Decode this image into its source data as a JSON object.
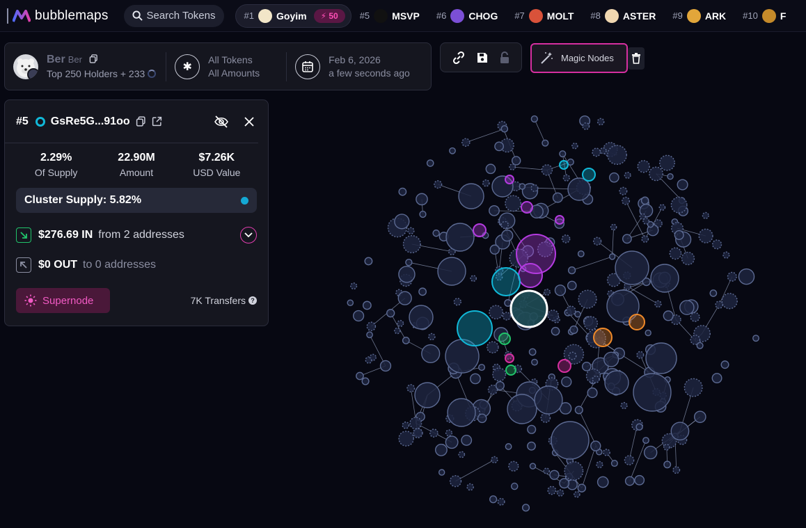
{
  "brand": {
    "name": "bubblemaps"
  },
  "search": {
    "label": "Search Tokens"
  },
  "tokens": [
    {
      "rank": "#1",
      "name": "Goyim",
      "icon": "goyim-token-icon",
      "color": "#f2e6c8",
      "active": true,
      "badge": "50"
    },
    {
      "rank": "#5",
      "name": "MSVP",
      "icon": "msvp-token-icon",
      "color": "#111111"
    },
    {
      "rank": "#6",
      "name": "CHOG",
      "icon": "chog-token-icon",
      "color": "#7b4fd6"
    },
    {
      "rank": "#7",
      "name": "MOLT",
      "icon": "molt-token-icon",
      "color": "#d9523a"
    },
    {
      "rank": "#8",
      "name": "ASTER",
      "icon": "aster-token-icon",
      "color": "#f0d7b0"
    },
    {
      "rank": "#9",
      "name": "ARK",
      "icon": "ark-token-icon",
      "color": "#e2a63a"
    },
    {
      "rank": "#10",
      "name": "F",
      "icon": "token-icon",
      "color": "#c58a2a"
    }
  ],
  "header": {
    "token_name": "Ber",
    "token_symbol": "Ber",
    "holders": "Top 250 Holders + 233",
    "filter_tokens": "All Tokens",
    "filter_amounts": "All Amounts",
    "date": "Feb 6, 2026",
    "date_relative": "a few seconds ago"
  },
  "toolbar": {
    "magic_nodes": "Magic Nodes"
  },
  "detail": {
    "rank": "#5",
    "address": "GsRe5G...91oo",
    "supply_pct": "2.29%",
    "supply_label": "Of Supply",
    "amount": "22.90M",
    "amount_label": "Amount",
    "usd": "$7.26K",
    "usd_label": "USD Value",
    "cluster_supply": "Cluster Supply: 5.82%",
    "in_amount": "$276.69 IN",
    "in_desc": "from 2 addresses",
    "out_amount": "$0 OUT",
    "out_desc": "to 0 addresses",
    "supernode": "Supernode",
    "transfers": "7K Transfers"
  },
  "colors": {
    "accent_pink": "#d62fa0",
    "cyan": "#11b8d8",
    "purple": "#b43be0",
    "green": "#21c46b",
    "orange": "#f08a2a",
    "node_fill": "#1d2540",
    "node_stroke": "#5c6a92"
  }
}
